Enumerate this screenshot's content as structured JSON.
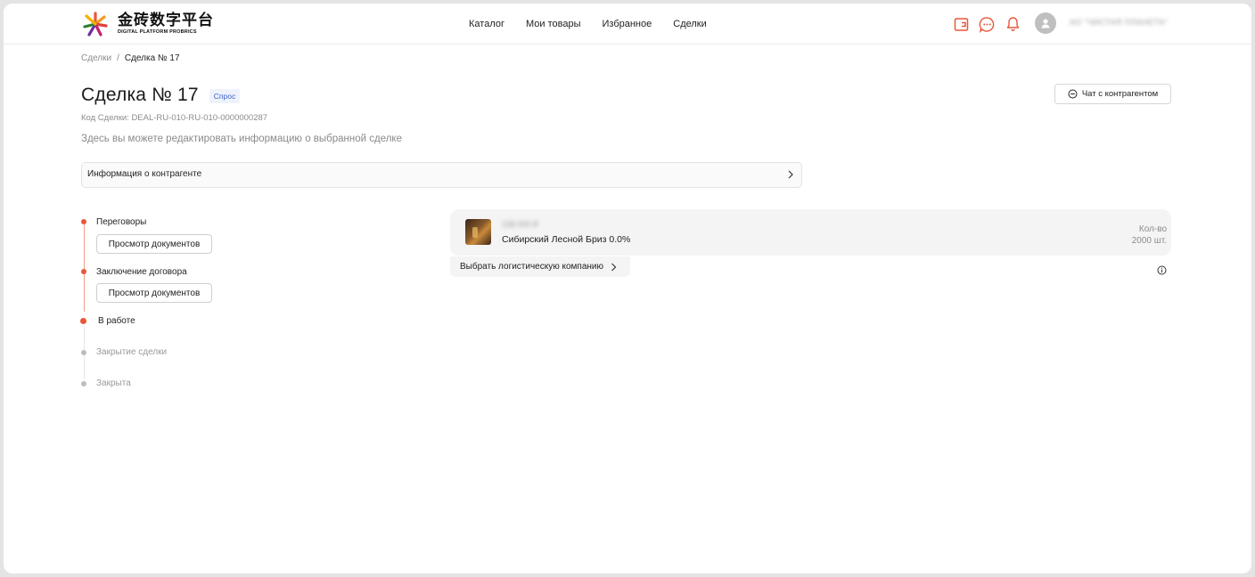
{
  "header": {
    "logo_title": "金砖数字平台",
    "logo_subtitle": "DIGITAL PLATFORM PROBRICS",
    "nav": [
      "Каталог",
      "Мои товары",
      "Избранное",
      "Сделки"
    ],
    "icons": [
      "wallet-icon",
      "chat-bubble-icon",
      "bell-icon"
    ],
    "user_name": "АО \"ЧИСТАЯ ПЛАНЕТА\""
  },
  "colors": {
    "accent": "#e8573a",
    "badge_text": "#3e61c7",
    "badge_bg": "#eef2fb"
  },
  "breadcrumb": {
    "parent": "Сделки",
    "separator": "/",
    "current": "Сделка № 17"
  },
  "deal": {
    "title": "Сделка № 17",
    "badge": "Спрос",
    "chat_button": "Чат с контрагентом",
    "code": "Код Сделки: DEAL-RU-010-RU-010-0000000287",
    "description": "Здесь вы можете редактировать информацию о выбранной сделке",
    "counterparty_info": "Информация о контрагенте"
  },
  "timeline": {
    "steps": [
      {
        "label": "Переговоры",
        "button": "Просмотр документов",
        "state": "done"
      },
      {
        "label": "Заключение договора",
        "button": "Просмотр документов",
        "state": "done"
      },
      {
        "label": "В работе",
        "state": "current"
      },
      {
        "label": "Закрытие сделки",
        "state": "pending"
      },
      {
        "label": "Закрыта",
        "state": "pending"
      }
    ]
  },
  "product": {
    "price": "238 000 ₽",
    "name": "Сибирский Лесной Бриз 0.0%",
    "qty_label": "Кол-во",
    "qty_value": "2000 шт.",
    "logistics_button": "Выбрать логистическую компанию"
  }
}
